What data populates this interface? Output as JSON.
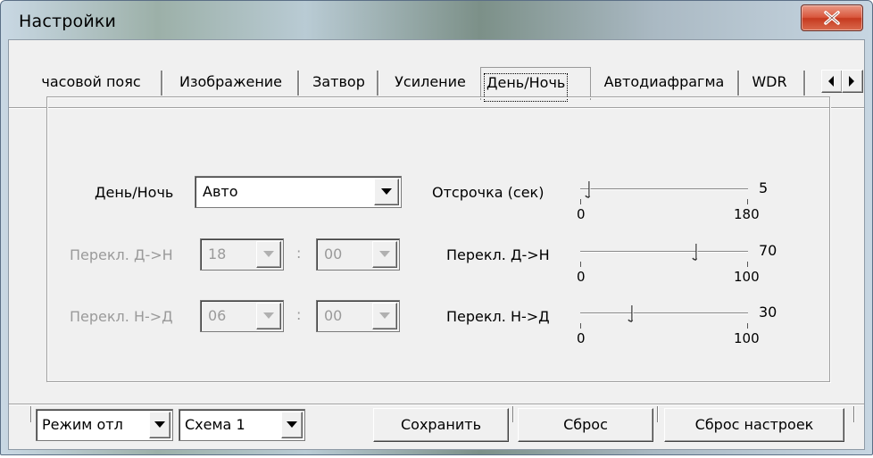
{
  "window": {
    "title": "Настройки"
  },
  "tabs": [
    {
      "label": "часовой пояс"
    },
    {
      "label": "Изображение"
    },
    {
      "label": "Затвор"
    },
    {
      "label": "Усиление"
    },
    {
      "label": "День/Ночь",
      "active": true
    },
    {
      "label": "Автодиафрагма"
    },
    {
      "label": "WDR"
    }
  ],
  "daynight": {
    "mode_label": "День/Ночь",
    "mode_value": "Авто",
    "d2n_label": "Перекл. Д->Н",
    "d2n_hour": "18",
    "d2n_min": "00",
    "n2d_label": "Перекл. Н->Д",
    "n2d_hour": "06",
    "n2d_min": "00",
    "colon": ":"
  },
  "sliders": [
    {
      "label": "Отсрочка (сек)",
      "value": 5,
      "min": 0,
      "max": 180,
      "value_text": "5",
      "min_text": "0",
      "max_text": "180"
    },
    {
      "label": "Перекл. Д->Н",
      "value": 70,
      "min": 0,
      "max": 100,
      "value_text": "70",
      "min_text": "0",
      "max_text": "100"
    },
    {
      "label": "Перекл. Н->Д",
      "value": 30,
      "min": 0,
      "max": 100,
      "value_text": "30",
      "min_text": "0",
      "max_text": "100"
    }
  ],
  "footer": {
    "mode_select": "Режим отл",
    "scheme_select": "Схема 1",
    "save": "Сохранить",
    "reset": "Сброс",
    "reset_settings": "Сброс настроек"
  },
  "colors": {
    "close": "#c63a1f",
    "face": "#f0f0f0",
    "disabled_text": "#9a9a9a"
  }
}
